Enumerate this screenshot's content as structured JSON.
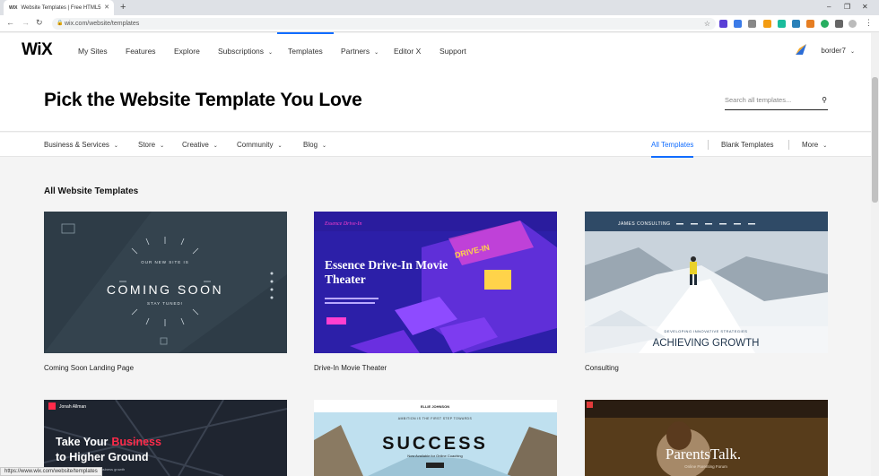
{
  "browser": {
    "tab_title": "Website Templates | Free HTML5",
    "tab_favicon": "WIX",
    "url": "wix.com/website/templates",
    "status_url": "https://www.wix.com/website/templates"
  },
  "header": {
    "logo": "WiX",
    "nav": [
      {
        "label": "My Sites"
      },
      {
        "label": "Features"
      },
      {
        "label": "Explore"
      },
      {
        "label": "Subscriptions"
      },
      {
        "label": "Templates"
      },
      {
        "label": "Partners"
      },
      {
        "label": "Editor X"
      },
      {
        "label": "Support"
      }
    ],
    "username": "border7"
  },
  "hero": {
    "title": "Pick the Website Template You Love",
    "search_placeholder": "Search all templates..."
  },
  "categories": {
    "left": [
      "Business & Services",
      "Store",
      "Creative",
      "Community",
      "Blog"
    ],
    "right": [
      "All Templates",
      "Blank Templates",
      "More"
    ]
  },
  "section_title": "All Website Templates",
  "templates": [
    {
      "caption": "Coming Soon Landing Page",
      "heading": "COMING SOON",
      "line1": "OUR NEW SITE IS",
      "line2": "STAY TUNED!"
    },
    {
      "caption": "Drive-In Movie Theater",
      "heading": "Essence Drive-In Movie Theater",
      "brand": "Essence Drive-In",
      "sign": "DRIVE-IN"
    },
    {
      "caption": "Consulting",
      "heading": "ACHIEVING GROWTH",
      "brand": "JAMES CONSULTING",
      "tag": "DEVELOPING INNOVATIVE STRATEGIES"
    },
    {
      "heading_white": "Take Your",
      "heading_red": "Business",
      "heading2": "to Higher Ground",
      "brand": "Jonah Allman",
      "sub": "Let me help you grow your business growth"
    },
    {
      "heading": "SUCCESS",
      "brand": "ELLIE JOHNSON",
      "tag": "AMBITION IS THE FIRST STEP TOWARDS",
      "sub": "Now Available for Online Coaching"
    },
    {
      "heading": "ParentsTalk.",
      "sub": "Online Parenting Forum"
    }
  ],
  "colors": {
    "accent": "#116dff",
    "business_red": "#ff2b4a",
    "drivein_pink": "#ff3fd0"
  }
}
